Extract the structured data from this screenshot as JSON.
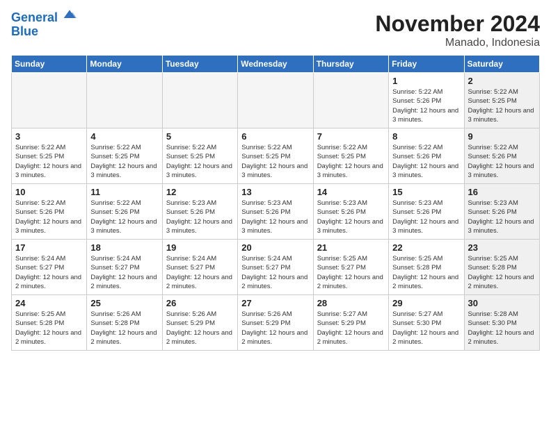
{
  "logo": {
    "line1": "General",
    "line2": "Blue"
  },
  "title": "November 2024",
  "location": "Manado, Indonesia",
  "weekdays": [
    "Sunday",
    "Monday",
    "Tuesday",
    "Wednesday",
    "Thursday",
    "Friday",
    "Saturday"
  ],
  "weeks": [
    [
      {
        "day": "",
        "info": "",
        "empty": true
      },
      {
        "day": "",
        "info": "",
        "empty": true
      },
      {
        "day": "",
        "info": "",
        "empty": true
      },
      {
        "day": "",
        "info": "",
        "empty": true
      },
      {
        "day": "",
        "info": "",
        "empty": true
      },
      {
        "day": "1",
        "info": "Sunrise: 5:22 AM\nSunset: 5:26 PM\nDaylight: 12 hours and 3 minutes."
      },
      {
        "day": "2",
        "info": "Sunrise: 5:22 AM\nSunset: 5:25 PM\nDaylight: 12 hours and 3 minutes.",
        "shaded": true
      }
    ],
    [
      {
        "day": "3",
        "info": "Sunrise: 5:22 AM\nSunset: 5:25 PM\nDaylight: 12 hours and 3 minutes."
      },
      {
        "day": "4",
        "info": "Sunrise: 5:22 AM\nSunset: 5:25 PM\nDaylight: 12 hours and 3 minutes."
      },
      {
        "day": "5",
        "info": "Sunrise: 5:22 AM\nSunset: 5:25 PM\nDaylight: 12 hours and 3 minutes."
      },
      {
        "day": "6",
        "info": "Sunrise: 5:22 AM\nSunset: 5:25 PM\nDaylight: 12 hours and 3 minutes."
      },
      {
        "day": "7",
        "info": "Sunrise: 5:22 AM\nSunset: 5:25 PM\nDaylight: 12 hours and 3 minutes."
      },
      {
        "day": "8",
        "info": "Sunrise: 5:22 AM\nSunset: 5:26 PM\nDaylight: 12 hours and 3 minutes."
      },
      {
        "day": "9",
        "info": "Sunrise: 5:22 AM\nSunset: 5:26 PM\nDaylight: 12 hours and 3 minutes.",
        "shaded": true
      }
    ],
    [
      {
        "day": "10",
        "info": "Sunrise: 5:22 AM\nSunset: 5:26 PM\nDaylight: 12 hours and 3 minutes."
      },
      {
        "day": "11",
        "info": "Sunrise: 5:22 AM\nSunset: 5:26 PM\nDaylight: 12 hours and 3 minutes."
      },
      {
        "day": "12",
        "info": "Sunrise: 5:23 AM\nSunset: 5:26 PM\nDaylight: 12 hours and 3 minutes."
      },
      {
        "day": "13",
        "info": "Sunrise: 5:23 AM\nSunset: 5:26 PM\nDaylight: 12 hours and 3 minutes."
      },
      {
        "day": "14",
        "info": "Sunrise: 5:23 AM\nSunset: 5:26 PM\nDaylight: 12 hours and 3 minutes."
      },
      {
        "day": "15",
        "info": "Sunrise: 5:23 AM\nSunset: 5:26 PM\nDaylight: 12 hours and 3 minutes."
      },
      {
        "day": "16",
        "info": "Sunrise: 5:23 AM\nSunset: 5:26 PM\nDaylight: 12 hours and 3 minutes.",
        "shaded": true
      }
    ],
    [
      {
        "day": "17",
        "info": "Sunrise: 5:24 AM\nSunset: 5:27 PM\nDaylight: 12 hours and 2 minutes."
      },
      {
        "day": "18",
        "info": "Sunrise: 5:24 AM\nSunset: 5:27 PM\nDaylight: 12 hours and 2 minutes."
      },
      {
        "day": "19",
        "info": "Sunrise: 5:24 AM\nSunset: 5:27 PM\nDaylight: 12 hours and 2 minutes."
      },
      {
        "day": "20",
        "info": "Sunrise: 5:24 AM\nSunset: 5:27 PM\nDaylight: 12 hours and 2 minutes."
      },
      {
        "day": "21",
        "info": "Sunrise: 5:25 AM\nSunset: 5:27 PM\nDaylight: 12 hours and 2 minutes."
      },
      {
        "day": "22",
        "info": "Sunrise: 5:25 AM\nSunset: 5:28 PM\nDaylight: 12 hours and 2 minutes."
      },
      {
        "day": "23",
        "info": "Sunrise: 5:25 AM\nSunset: 5:28 PM\nDaylight: 12 hours and 2 minutes.",
        "shaded": true
      }
    ],
    [
      {
        "day": "24",
        "info": "Sunrise: 5:25 AM\nSunset: 5:28 PM\nDaylight: 12 hours and 2 minutes."
      },
      {
        "day": "25",
        "info": "Sunrise: 5:26 AM\nSunset: 5:28 PM\nDaylight: 12 hours and 2 minutes."
      },
      {
        "day": "26",
        "info": "Sunrise: 5:26 AM\nSunset: 5:29 PM\nDaylight: 12 hours and 2 minutes."
      },
      {
        "day": "27",
        "info": "Sunrise: 5:26 AM\nSunset: 5:29 PM\nDaylight: 12 hours and 2 minutes."
      },
      {
        "day": "28",
        "info": "Sunrise: 5:27 AM\nSunset: 5:29 PM\nDaylight: 12 hours and 2 minutes."
      },
      {
        "day": "29",
        "info": "Sunrise: 5:27 AM\nSunset: 5:30 PM\nDaylight: 12 hours and 2 minutes."
      },
      {
        "day": "30",
        "info": "Sunrise: 5:28 AM\nSunset: 5:30 PM\nDaylight: 12 hours and 2 minutes.",
        "shaded": true
      }
    ]
  ]
}
